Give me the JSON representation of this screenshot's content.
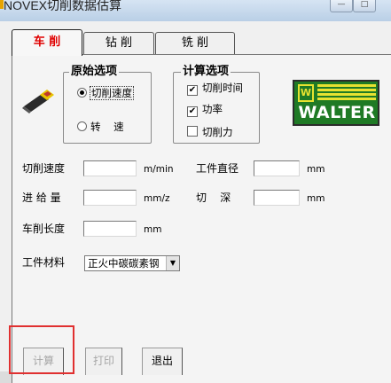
{
  "window": {
    "title": "NOVEX切削数据估算",
    "minimize_glyph": "—",
    "maximize_glyph": "□"
  },
  "tabs": [
    {
      "label": "车  削",
      "selected": true
    },
    {
      "label": "钻  削",
      "selected": false
    },
    {
      "label": "铣  削",
      "selected": false
    }
  ],
  "original_options": {
    "title": "原始选项",
    "options": [
      {
        "label": "切削速度",
        "selected": true
      },
      {
        "label": "转    速",
        "selected": false
      }
    ]
  },
  "calc_options": {
    "title": "计算选项",
    "options": [
      {
        "label": "切削时间",
        "checked": true
      },
      {
        "label": "功率",
        "checked": true
      },
      {
        "label": "切削力",
        "checked": false
      }
    ],
    "check_mark": "✔"
  },
  "logo": {
    "text": "WALTER",
    "mark": "W"
  },
  "fields": {
    "cutting_speed": {
      "label": "切削速度",
      "unit": "m/min",
      "value": ""
    },
    "workpiece_diameter": {
      "label": "工件直径",
      "unit": "mm",
      "value": ""
    },
    "feed": {
      "label": "进 给 量",
      "unit": "mm/z",
      "value": ""
    },
    "depth_of_cut": {
      "label": "切    深",
      "unit": "mm",
      "value": ""
    },
    "turning_length": {
      "label": "车削长度",
      "unit": "mm",
      "value": ""
    }
  },
  "material": {
    "label": "工件材料",
    "selected": "正火中碳碳素钢",
    "arrow": "▼"
  },
  "buttons": {
    "calculate": "计算",
    "print": "打印",
    "exit": "退出"
  },
  "colors": {
    "selected_tab_text": "#e00000",
    "highlight_border": "#e03030",
    "logo_green": "#1f7a25",
    "logo_yellow": "#e7e230"
  }
}
